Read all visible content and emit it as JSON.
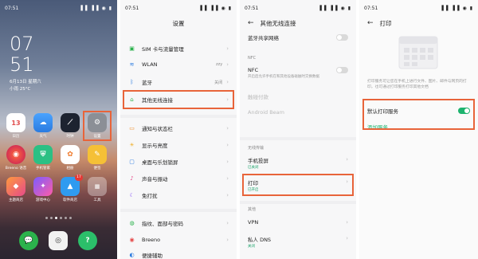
{
  "status": {
    "time": "07:51",
    "signal": "▐▐ ▐▐ ◉ ▮"
  },
  "home": {
    "clock_h": "07",
    "clock_m": "51",
    "date": "6月13日 星期六",
    "weather": "小雨 25°C",
    "apps_row1": [
      "日历",
      "天气",
      "时钟",
      "设置"
    ],
    "apps_row2": [
      "Breeno 语音",
      "手机管家",
      "相册",
      "便签"
    ],
    "apps_row3": [
      "主题商店",
      "游戏中心",
      "软件商店",
      "工具"
    ],
    "calendar_day": "13",
    "store_badge": "17"
  },
  "settings": {
    "title": "设置",
    "items": [
      {
        "label": "SIM 卡与流量管理"
      },
      {
        "label": "WLAN",
        "value": "zzy"
      },
      {
        "label": "蓝牙",
        "value": "关闭"
      },
      {
        "label": "其他无线连接"
      },
      {
        "label": "通知与状态栏"
      },
      {
        "label": "显示与亮度"
      },
      {
        "label": "桌面与乐划锁屏"
      },
      {
        "label": "声音与振动"
      },
      {
        "label": "免打扰"
      },
      {
        "label": "指纹、面部与密码"
      },
      {
        "label": "Breeno"
      },
      {
        "label": "便捷辅助"
      }
    ]
  },
  "wireless": {
    "title": "其他无线连接",
    "bt_share": "蓝牙共享网络",
    "nfc_section": "NFC",
    "nfc_label": "NFC",
    "nfc_desc": "开启后允许手机在和其他设备碰触时交换数据",
    "touch_pay": "触碰付款",
    "android_beam": "Android Beam",
    "android_beam_desc": "",
    "cast_section": "无线传输",
    "cast_label": "手机投屏",
    "cast_sub": "已关闭",
    "print_label": "打印",
    "print_sub": "已开启",
    "other_section": "其他",
    "vpn": "VPN",
    "private_dns": "私人 DNS",
    "private_dns_sub": "关闭"
  },
  "print": {
    "title": "打印",
    "desc": "打印服务可让您在手机上进行文件、图片、邮件与网页的打印，也可通过打印服务打印其他文档",
    "default_service": "默认打印服务",
    "add_service": "添加服务"
  },
  "colors": {
    "accent": "#1db36e",
    "highlight": "#e8643a"
  }
}
